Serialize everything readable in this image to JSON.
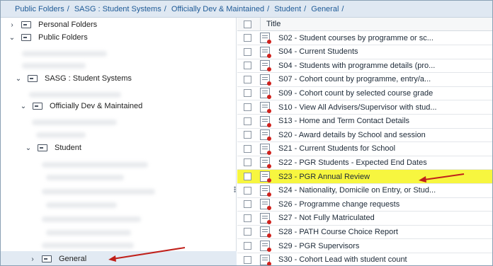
{
  "breadcrumb": [
    "Public Folders",
    "SASG : Student Systems",
    "Officially Dev & Maintained",
    "Student",
    "General"
  ],
  "breadcrumb_sep": "/",
  "tree": {
    "personal_folders": "Personal Folders",
    "public_folders": "Public Folders",
    "sasg": "SASG : Student Systems",
    "official": "Officially Dev & Maintained",
    "student": "Student",
    "general": "General"
  },
  "table": {
    "header_title": "Title",
    "rows": [
      "S02 - Student courses by programme or sc...",
      "S04 - Current Students",
      "S04 - Students with programme details (pro...",
      "S07 - Cohort count by programme, entry/a...",
      "S09 - Cohort count by selected course grade",
      "S10 - View All Advisers/Supervisor with stud...",
      "S13 - Home and Term Contact Details",
      "S20 - Award details by School and session",
      "S21 - Current Students for School",
      "S22 - PGR Students - Expected End Dates",
      "S23 - PGR Annual Review",
      "S24 - Nationality, Domicile on Entry, or Stud...",
      "S26 - Programme change requests",
      "S27 - Not Fully Matriculated",
      "S28 - PATH Course Choice Report",
      "S29 - PGR Supervisors",
      "S30 - Cohort Lead with student count"
    ],
    "highlighted_row": "S23 - PGR Annual Review"
  },
  "colors": {
    "highlight": "#f7f63f",
    "arrow": "#c0201a",
    "link": "#1e5a96"
  }
}
